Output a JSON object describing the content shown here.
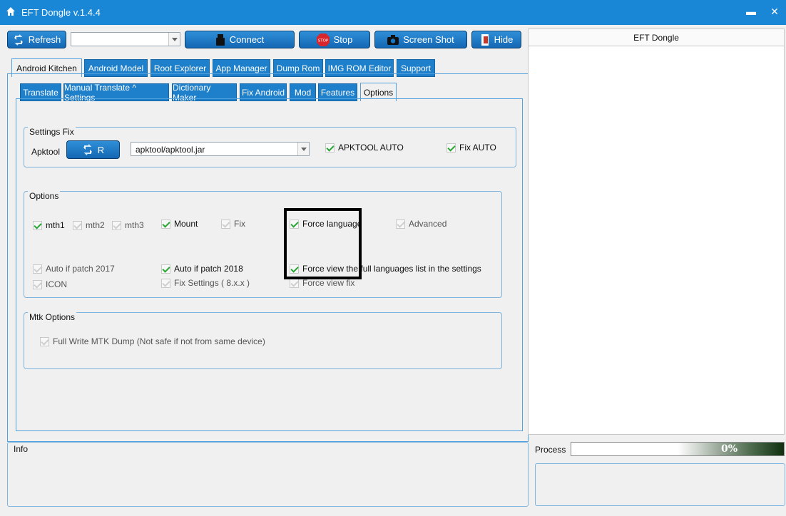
{
  "window": {
    "title": "EFT Dongle  v.1.4.4",
    "home_icon": "home-icon",
    "min_label": "▬",
    "close_label": "✕"
  },
  "toolbar": {
    "refresh_label": "Refresh",
    "device_combo_value": "",
    "connect_label": "Connect",
    "stop_label": "Stop",
    "stop_badge": "STOP",
    "screenshot_label": "Screen Shot",
    "hide_label": "Hide"
  },
  "main_tabs": [
    {
      "label": "Android Kitchen",
      "active": true
    },
    {
      "label": "Android Model"
    },
    {
      "label": "Root Explorer"
    },
    {
      "label": "App Manager"
    },
    {
      "label": "Dump Rom"
    },
    {
      "label": "IMG ROM Editor"
    },
    {
      "label": "Support"
    }
  ],
  "sub_tabs": [
    {
      "label": "Translate"
    },
    {
      "label": "Manual Translate ^ Settings"
    },
    {
      "label": "Dictionary Maker"
    },
    {
      "label": "Fix Android"
    },
    {
      "label": "Mod"
    },
    {
      "label": "Features"
    },
    {
      "label": "Options",
      "active": true
    }
  ],
  "settings_fix": {
    "title": "Settings  Fix",
    "apktool_label": "Apktool",
    "r_button_label": "R",
    "apktool_path": "apktool/apktool.jar",
    "apktool_auto_label": "APKTOOL AUTO",
    "apktool_auto_checked": true,
    "fix_auto_label": "Fix AUTO",
    "fix_auto_checked": true
  },
  "options": {
    "title": "Options",
    "items": [
      {
        "label": "mth1",
        "checked": true
      },
      {
        "label": "mth2",
        "checked": false
      },
      {
        "label": "mth3",
        "checked": false
      },
      {
        "label": "Mount",
        "checked": true
      },
      {
        "label": "Fix",
        "checked": false
      },
      {
        "label": "Force language",
        "checked": true
      },
      {
        "label": "Advanced",
        "checked": false
      },
      {
        "label": "Auto if patch 2017",
        "checked": false
      },
      {
        "label": "Auto if patch 2018",
        "checked": true
      },
      {
        "label": "Force view the full languages list in the settings",
        "checked": true
      },
      {
        "label": "ICON",
        "checked": false
      },
      {
        "label": "Fix Settings ( 8.x.x )",
        "checked": false
      },
      {
        "label": "Force view fix",
        "checked": false
      }
    ]
  },
  "mtk_options": {
    "title": "Mtk Options",
    "full_write_label": "Full Write MTK Dump (Not safe if not from same device)",
    "full_write_checked": false
  },
  "right_panel": {
    "header": "EFT Dongle"
  },
  "info": {
    "label": "Info"
  },
  "process": {
    "label": "Process",
    "percent_text": "0%",
    "value": 0
  },
  "colors": {
    "titlebar": "#1a86d6",
    "button": "#1e7fcb",
    "check": "#27a632"
  }
}
